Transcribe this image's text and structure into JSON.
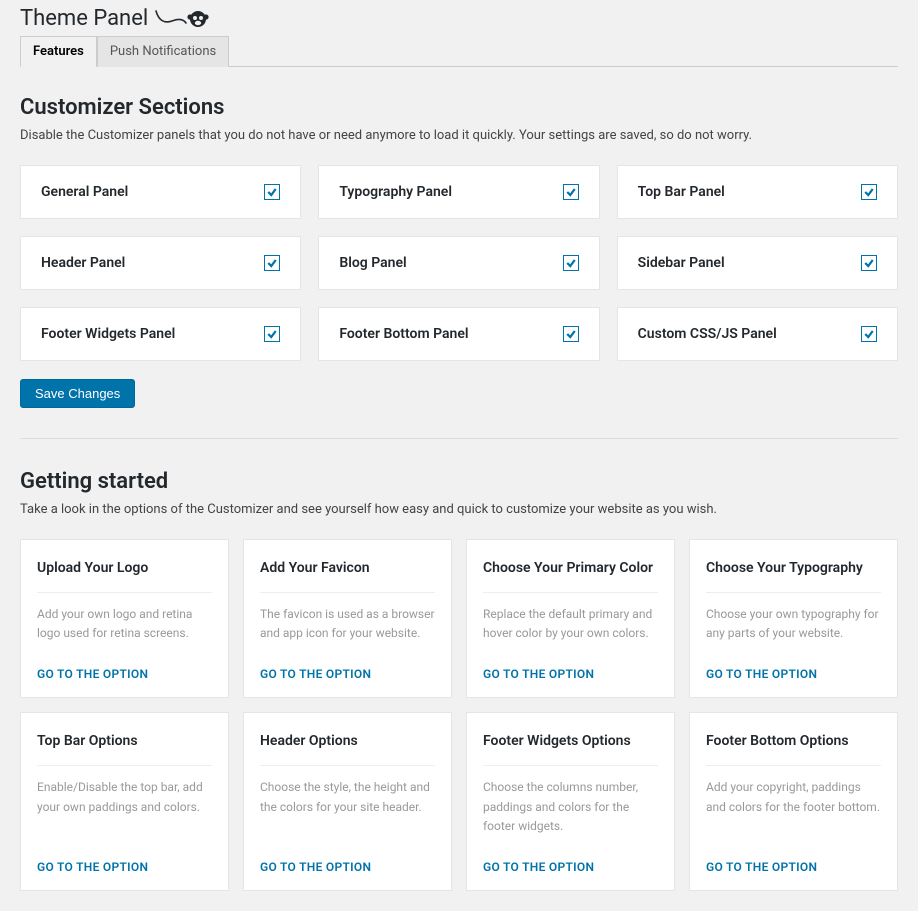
{
  "page_title": "Theme Panel",
  "tabs": [
    {
      "label": "Features"
    },
    {
      "label": "Push Notifications"
    }
  ],
  "customizer": {
    "heading": "Customizer Sections",
    "description": "Disable the Customizer panels that you do not have or need anymore to load it quickly. Your settings are saved, so do not worry.",
    "panels": [
      {
        "label": "General Panel",
        "checked": true
      },
      {
        "label": "Typography Panel",
        "checked": true
      },
      {
        "label": "Top Bar Panel",
        "checked": true
      },
      {
        "label": "Header Panel",
        "checked": true
      },
      {
        "label": "Blog Panel",
        "checked": true
      },
      {
        "label": "Sidebar Panel",
        "checked": true
      },
      {
        "label": "Footer Widgets Panel",
        "checked": true
      },
      {
        "label": "Footer Bottom Panel",
        "checked": true
      },
      {
        "label": "Custom CSS/JS Panel",
        "checked": true
      }
    ],
    "save_label": "Save Changes"
  },
  "getting_started": {
    "heading": "Getting started",
    "description": "Take a look in the options of the Customizer and see yourself how easy and quick to customize your website as you wish.",
    "link_label": "GO TO THE OPTION",
    "cards": [
      {
        "title": "Upload Your Logo",
        "desc": "Add your own logo and retina logo used for retina screens."
      },
      {
        "title": "Add Your Favicon",
        "desc": "The favicon is used as a browser and app icon for your website."
      },
      {
        "title": "Choose Your Primary Color",
        "desc": "Replace the default primary and hover color by your own colors."
      },
      {
        "title": "Choose Your Typography",
        "desc": "Choose your own typography for any parts of your website."
      },
      {
        "title": "Top Bar Options",
        "desc": "Enable/Disable the top bar, add your own paddings and colors."
      },
      {
        "title": "Header Options",
        "desc": "Choose the style, the height and the colors for your site header."
      },
      {
        "title": "Footer Widgets Options",
        "desc": "Choose the columns number, paddings and colors for the footer widgets."
      },
      {
        "title": "Footer Bottom Options",
        "desc": "Add your copyright, paddings and colors for the footer bottom."
      }
    ]
  }
}
